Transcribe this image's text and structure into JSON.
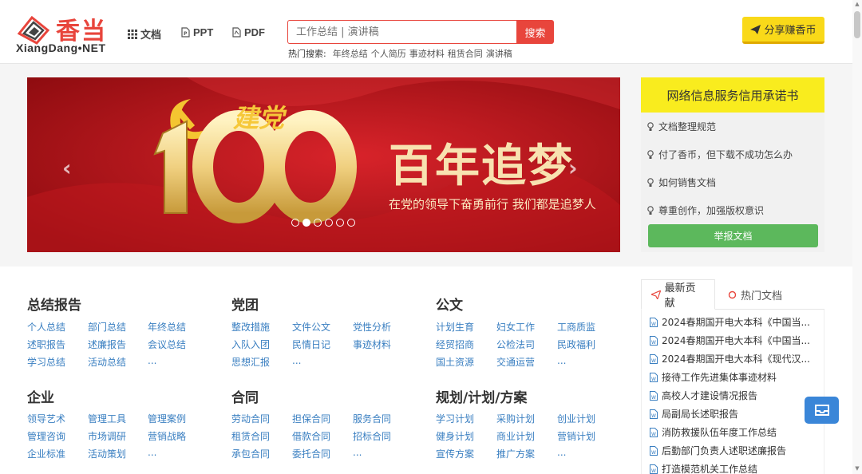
{
  "logo": {
    "cn": "香当",
    "en": "XiangDang•NET"
  },
  "nav": {
    "doc": "文档",
    "ppt": "PPT",
    "pdf": "PDF"
  },
  "search": {
    "placeholder": "工作总结 | 演讲稿",
    "button": "搜索"
  },
  "hot": {
    "label": "热门搜索:",
    "items": [
      "年终总结",
      "个人简历",
      "事迹材料",
      "租赁合同",
      "演讲稿"
    ]
  },
  "share_button": "分享赚香币",
  "banner": {
    "party_text": "建党",
    "big_number": "100",
    "headline": "百年追梦",
    "subline": "在党的领导下奋勇前行 我们都是追梦人",
    "dot_count": 6,
    "active_dot": 1
  },
  "promise": {
    "title": "网络信息服务信用承诺书",
    "items": [
      "文档整理规范",
      "付了香币，但下载不成功怎么办",
      "如何销售文档",
      "尊重创作，加强版权意识"
    ],
    "report_button": "举报文档"
  },
  "categories": [
    {
      "title": "总结报告",
      "links": [
        "个人总结",
        "部门总结",
        "年终总结",
        "述职报告",
        "述廉报告",
        "会议总结",
        "学习总结",
        "活动总结",
        "..."
      ]
    },
    {
      "title": "党团",
      "links": [
        "整改措施",
        "文件公文",
        "党性分析",
        "入队入团",
        "民情日记",
        "事迹材料",
        "思想汇报",
        "..."
      ]
    },
    {
      "title": "公文",
      "links": [
        "计划生育",
        "妇女工作",
        "工商质监",
        "经贸招商",
        "公检法司",
        "民政福利",
        "国土资源",
        "交通运营",
        "..."
      ]
    },
    {
      "title": "企业",
      "links": [
        "领导艺术",
        "管理工具",
        "管理案例",
        "管理咨询",
        "市场调研",
        "营销战略",
        "企业标准",
        "活动策划",
        "..."
      ]
    },
    {
      "title": "合同",
      "links": [
        "劳动合同",
        "担保合同",
        "服务合同",
        "租赁合同",
        "借款合同",
        "招标合同",
        "承包合同",
        "委托合同",
        "..."
      ]
    },
    {
      "title": "规划/计划/方案",
      "links": [
        "学习计划",
        "采购计划",
        "创业计划",
        "健身计划",
        "商业计划",
        "营销计划",
        "宣传方案",
        "推广方案",
        "..."
      ]
    }
  ],
  "tabs": {
    "latest": "最新贡献",
    "hot": "热门文档"
  },
  "docs": [
    "2024春期国开电大本科《中国当...",
    "2024春期国开电大本科《中国当...",
    "2024春期国开电大本科《现代汉...",
    "接待工作先进集体事迹材料",
    "高校人才建设情况报告",
    "局副局长述职报告",
    "消防救援队伍年度工作总结",
    "后勤部门负责人述职述廉报告",
    "打造模范机关工作总结"
  ],
  "colors": {
    "brand_red": "#e8453c",
    "yellow": "#f9d919",
    "link_blue": "#3a7fc1",
    "green": "#5cb85c",
    "banner_red": "#b8141a"
  }
}
